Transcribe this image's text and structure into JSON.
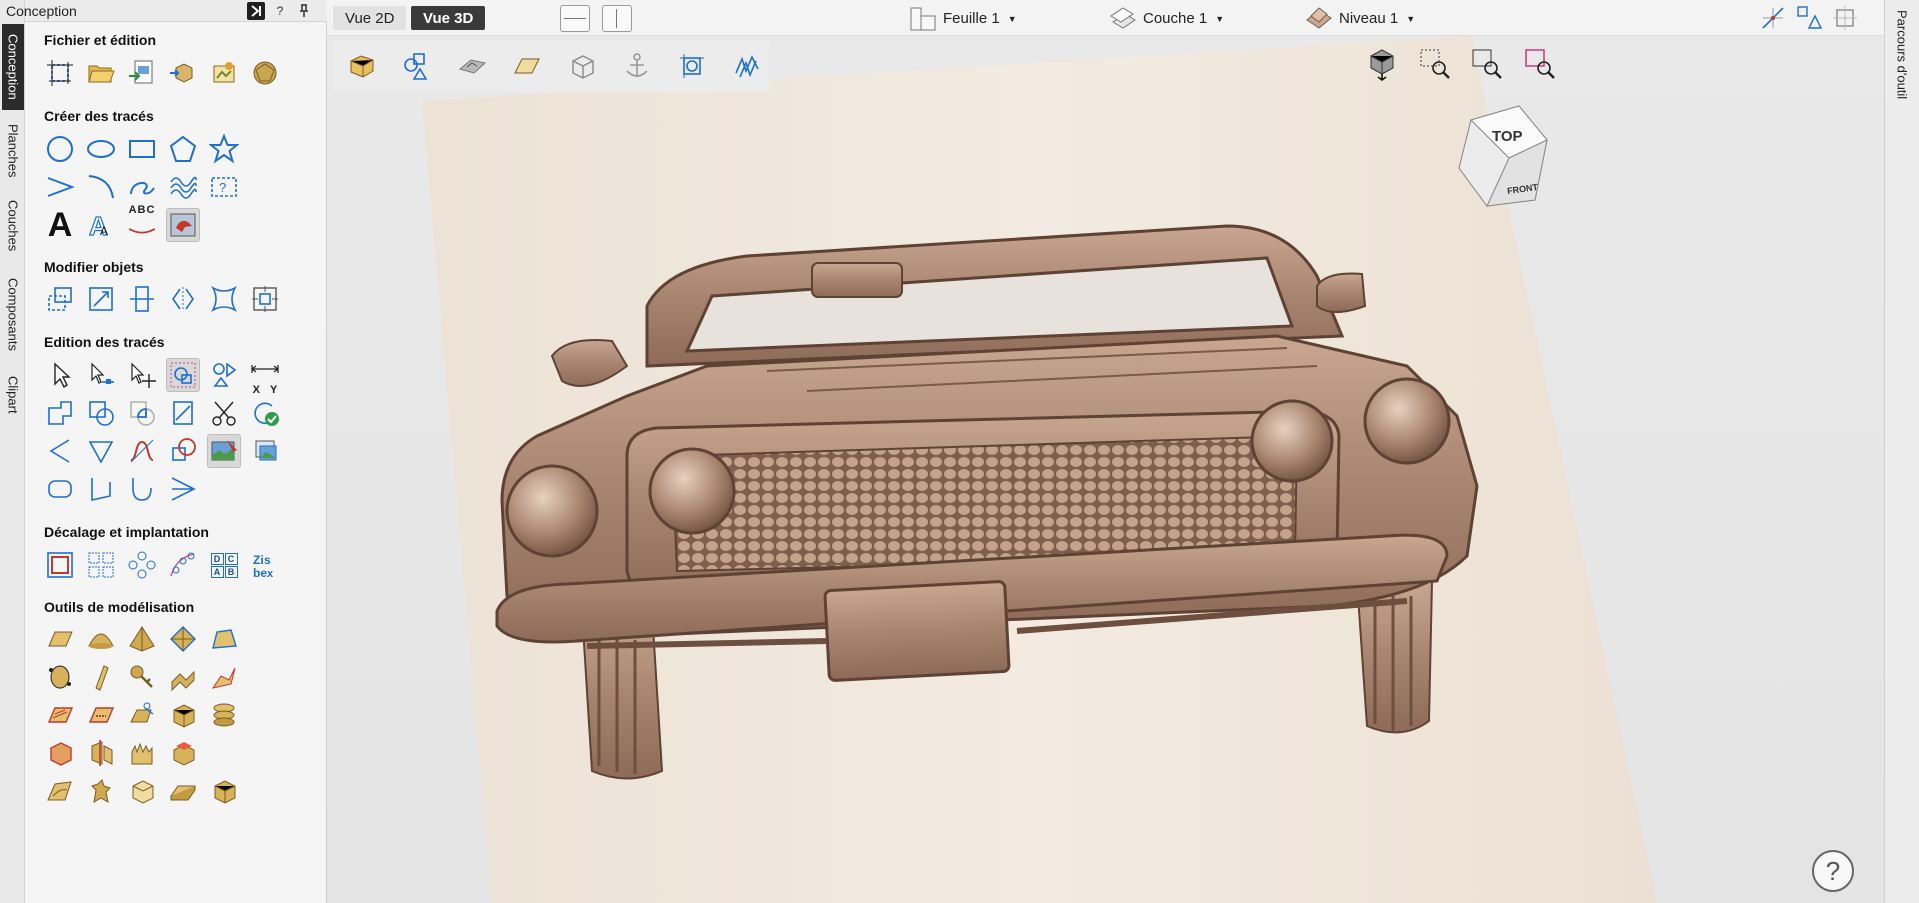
{
  "left_tabs": [
    "Conception",
    "Planches",
    "Couches",
    "Composants",
    "Clipart"
  ],
  "panel": {
    "title": "Conception",
    "help": "?",
    "pin": "⊥",
    "sections": {
      "file": "Fichier et édition",
      "create": "Créer des tracés",
      "modify": "Modifier objets",
      "edit": "Edition des tracés",
      "offset": "Décalage et implantation",
      "model": "Outils de modélisation"
    },
    "text_tools": {
      "big_a": "A",
      "abc": "ABC",
      "xy_x": "X",
      "xy_y": "Y",
      "nest": "Zi be",
      "dc": "D C A B"
    }
  },
  "topbar": {
    "vue2d": "Vue 2D",
    "vue3d": "Vue 3D",
    "sheet": "Feuille 1",
    "layer": "Couche 1",
    "level": "Niveau 1"
  },
  "right_tab": "Parcours d'outil",
  "viewcube": {
    "top": "TOP",
    "front": "FRONT"
  },
  "help_button": "?",
  "colors": {
    "accent": "#1e6fd0",
    "active_tab": "#2b2b2b",
    "model": "#b39178",
    "wood": "#efe5da"
  }
}
